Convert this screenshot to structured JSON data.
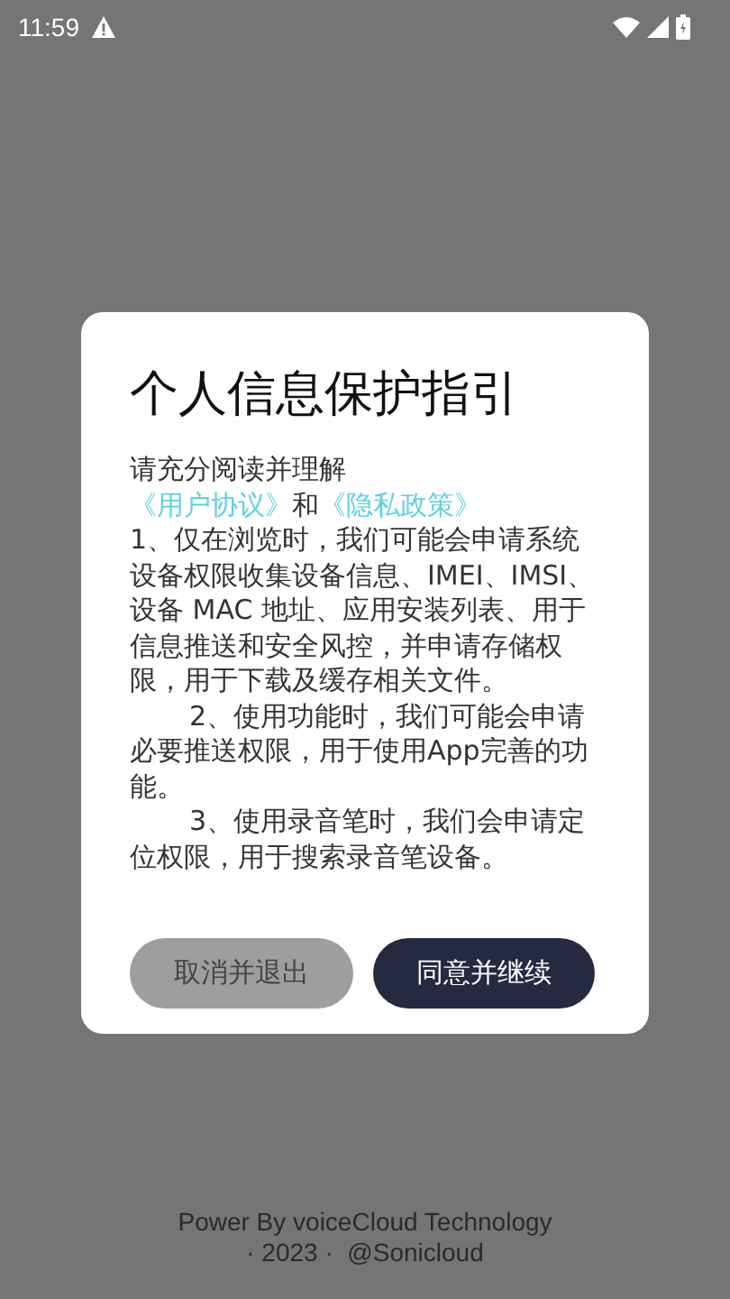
{
  "status_bar": {
    "time": "11:59"
  },
  "dialog": {
    "title": "个人信息保护指引",
    "intro": "请充分阅读并理解",
    "links": [
      {
        "kind": "link",
        "text": "《用户协议》"
      },
      {
        "kind": "plain",
        "text": "和"
      },
      {
        "kind": "link",
        "text": "《隐私政策》"
      }
    ],
    "paragraphs": [
      {
        "indented": false,
        "text": "1、仅在浏览时，我们可能会申请系统设备权限收集设备信息、IMEI、IMSI、设备 MAC 地址、应用安装列表、用于信息推送和安全风控，并申请存储权限，用于下载及缓存相关文件。"
      },
      {
        "indented": true,
        "text": "2、使用功能时，我们可能会申请必要推送权限，用于使用App完善的功能。"
      },
      {
        "indented": true,
        "text": "3、使用录音笔时，我们会申请定位权限，用于搜索录音笔设备。"
      }
    ],
    "buttons": [
      {
        "kind": "secondary",
        "label": "取消并退出"
      },
      {
        "kind": "primary",
        "label": "同意并继续"
      }
    ]
  },
  "footer": {
    "lines": [
      "Power By voiceCloud Technology",
      "· 2023 ·  @Sonicloud"
    ]
  }
}
